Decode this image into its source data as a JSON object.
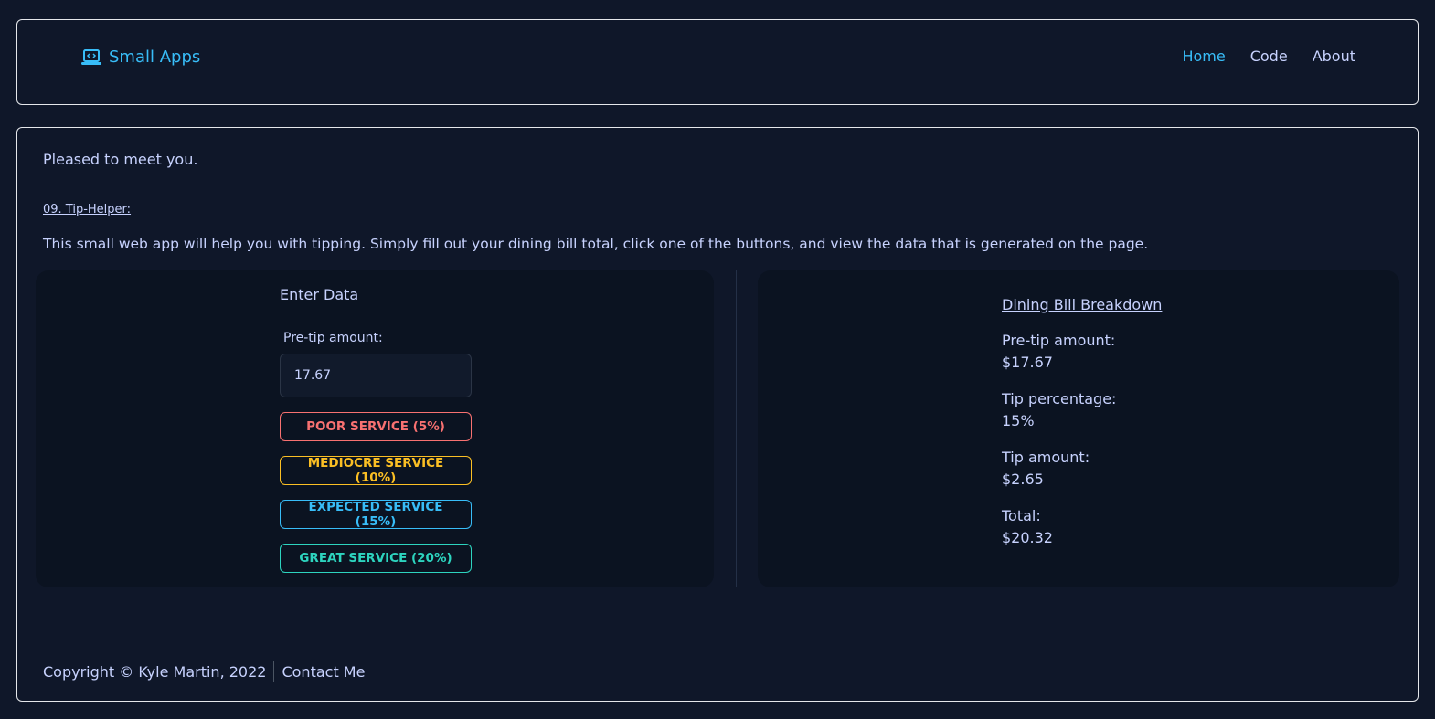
{
  "header": {
    "brand": "Small Apps",
    "brand_icon": "laptop-code-icon",
    "nav": [
      {
        "label": "Home",
        "active": true
      },
      {
        "label": "Code",
        "active": false
      },
      {
        "label": "About",
        "active": false
      }
    ]
  },
  "main": {
    "greeting": "Pleased to meet you.",
    "app_title": "09. Tip-Helper:",
    "description": "This small web app will help you with tipping. Simply fill out your dining bill total, click one of the buttons, and view the data that is generated on the page.",
    "form": {
      "title": "Enter Data",
      "label": "Pre-tip amount:",
      "input_value": "17.67",
      "buttons": {
        "poor": "POOR SERVICE (5%)",
        "mediocre": "MEDIOCRE SERVICE (10%)",
        "expected": "EXPECTED SERVICE (15%)",
        "great": "GREAT SERVICE (20%)"
      }
    },
    "breakdown": {
      "title": "Dining Bill Breakdown",
      "pretip_label": "Pre-tip amount:",
      "pretip_value": "$17.67",
      "percent_label": "Tip percentage:",
      "percent_value": "15%",
      "tip_label": "Tip amount:",
      "tip_value": "$2.65",
      "total_label": "Total:",
      "total_value": "$20.32"
    }
  },
  "footer": {
    "copyright": "Copyright © Kyle Martin, 2022",
    "contact": "Contact Me"
  },
  "colors": {
    "background": "#0f1729",
    "accent": "#38bdf8",
    "text": "#c7d2fe",
    "poor": "#f87171",
    "mediocre": "#fbbf24",
    "expected": "#38bdf8",
    "great": "#2dd4bf"
  }
}
